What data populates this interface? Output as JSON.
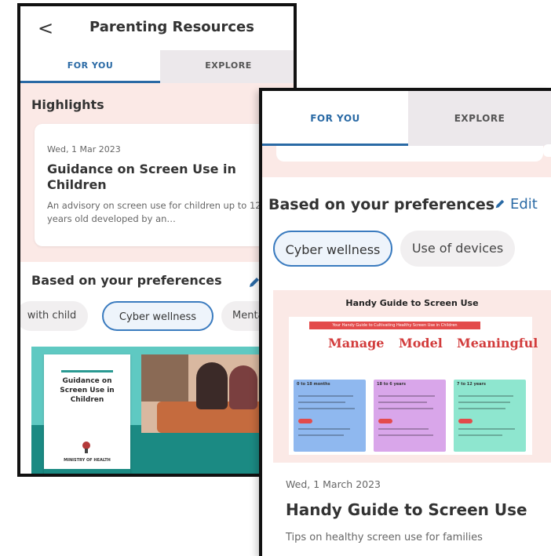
{
  "screen1": {
    "header": {
      "back_glyph": "<",
      "title": "Parenting Resources"
    },
    "tabs": [
      {
        "label": "FOR YOU",
        "active": true
      },
      {
        "label": "EXPLORE",
        "active": false
      }
    ],
    "highlights": {
      "title": "Highlights",
      "card": {
        "date": "Wed, 1 Mar 2023",
        "title": "Guidance on Screen Use in Children",
        "description": "An advisory on screen use for children up to 12 years old developed by an…"
      }
    },
    "preferences": {
      "title": "Based on your preferences",
      "chips": [
        {
          "label": "with child",
          "selected": false
        },
        {
          "label": "Cyber wellness",
          "selected": true
        },
        {
          "label": "Menta",
          "selected": false
        }
      ]
    },
    "feature_image": {
      "poster_title": "Guidance on Screen Use in Children",
      "poster_org": "MINISTRY OF HEALTH"
    }
  },
  "screen2": {
    "tabs": [
      {
        "label": "FOR YOU",
        "active": true
      },
      {
        "label": "EXPLORE",
        "active": false
      }
    ],
    "preferences": {
      "title": "Based on your preferences",
      "edit_label": "Edit",
      "chips": [
        {
          "label": "Cyber wellness",
          "selected": true
        },
        {
          "label": "Use of devices",
          "selected": false
        }
      ]
    },
    "feature_card": {
      "image_title": "Handy Guide to Screen Use",
      "infographic": {
        "banner": "Your Handy Guide to Cultivating Healthy Screen Use in Children",
        "pillars": [
          "Manage",
          "Model",
          "Meaningful"
        ],
        "age_groups": [
          "0 to 18 months",
          "18 to 6 years",
          "7 to 12 years"
        ]
      },
      "date": "Wed, 1 March 2023",
      "title": "Handy Guide to Screen Use",
      "description": "Tips on healthy screen use for families"
    }
  },
  "colors": {
    "accent": "#2a6aa5",
    "highlight_bg": "#fbe9e6",
    "inactive_tab_bg": "#ece8eb",
    "chip_bg": "#f1eff0",
    "teal": "#1b8a83"
  },
  "icons": [
    "chevron-left-icon",
    "pencil-icon",
    "moh-logo-icon"
  ]
}
